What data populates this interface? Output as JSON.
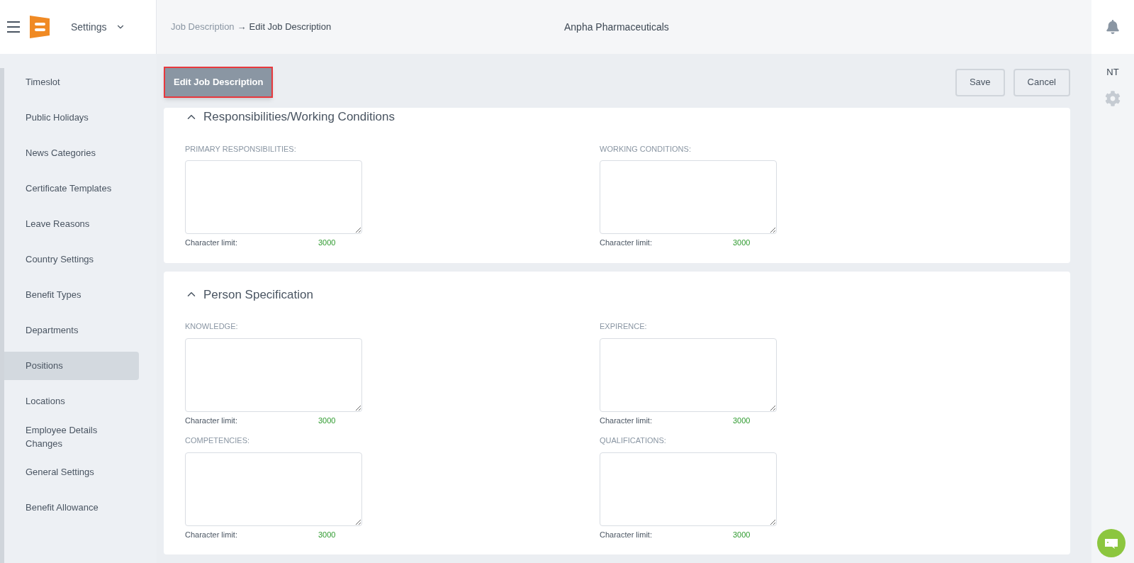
{
  "header": {
    "module": "Settings",
    "breadcrumb": [
      {
        "label": "Job Description",
        "current": false
      },
      {
        "label": "Edit Job Description",
        "current": true
      }
    ],
    "breadcrumb_separator": "→",
    "company": "Anpha Pharmaceuticals"
  },
  "user_initials": "NT",
  "sidebar": {
    "items": [
      {
        "label": "Timeslot",
        "selected": false
      },
      {
        "label": "Public Holidays",
        "selected": false
      },
      {
        "label": "News Categories",
        "selected": false
      },
      {
        "label": "Certificate Templates",
        "selected": false
      },
      {
        "label": "Leave Reasons",
        "selected": false
      },
      {
        "label": "Country Settings",
        "selected": false
      },
      {
        "label": "Benefit Types",
        "selected": false
      },
      {
        "label": "Departments",
        "selected": false
      },
      {
        "label": "Positions",
        "selected": true
      },
      {
        "label": "Locations",
        "selected": false
      },
      {
        "label": "Employee Details Changes",
        "selected": false
      },
      {
        "label": "General Settings",
        "selected": false
      },
      {
        "label": "Benefit Allowance",
        "selected": false
      }
    ]
  },
  "page_title": "Edit Job Description",
  "actions": [
    "Save",
    "Cancel"
  ],
  "sections": [
    {
      "title": "Responsibilities/Working Conditions",
      "expanded": true,
      "fields": [
        {
          "label": "PRIMARY RESPONSIBILITIES:",
          "limit_label": "Character limit:",
          "limit": "3000"
        },
        {
          "label": "WORKING CONDITIONS:",
          "limit_label": "Character limit:",
          "limit": "3000"
        }
      ]
    },
    {
      "title": "Person Specification",
      "expanded": true,
      "fields": [
        {
          "label": "KNOWLEDGE:",
          "limit_label": "Character limit:",
          "limit": "3000"
        },
        {
          "label": "EXPIRENCE:",
          "limit_label": "Character limit:",
          "limit": "3000"
        },
        {
          "label": "COMPETENCIES:",
          "limit_label": "Character limit:",
          "limit": "3000"
        },
        {
          "label": "QUALIFICATIONS:",
          "limit_label": "Character limit:",
          "limit": "3000"
        }
      ]
    }
  ]
}
